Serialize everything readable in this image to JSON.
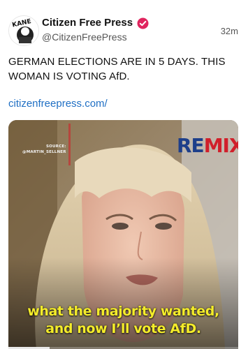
{
  "post": {
    "author_name": "Citizen Free Press",
    "author_handle": "@CitizenFreePress",
    "timestamp": "32m",
    "avatar_text": "KANE",
    "verified_color": "#e0245e",
    "body_lines": [
      "GERMAN ELECTIONS ARE IN 5 DAYS. THIS",
      "WOMAN IS VOTING AfD."
    ],
    "link_text": "citizenfreepress.com/"
  },
  "video": {
    "source_label": "SOURCE:",
    "source_credit": "@MARTIN_SELLNER",
    "logo_re": "RE",
    "logo_mix": "MIX",
    "caption_lines": [
      "what the majority wanted,",
      "and now I’ll vote AfD."
    ],
    "progress_fraction": 0.18,
    "colors": {
      "caption": "#f4ec2a",
      "logo_blue": "#1e3f8a",
      "logo_red": "#d11f2a"
    }
  }
}
